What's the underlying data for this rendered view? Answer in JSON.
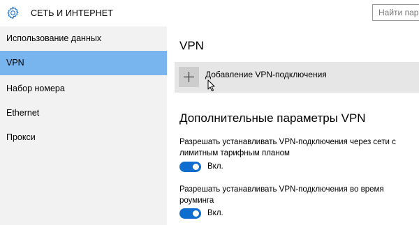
{
  "header": {
    "title": "СЕТЬ И ИНТЕРНЕТ",
    "search_placeholder": "Найти парам"
  },
  "sidebar": {
    "items": [
      {
        "label": "Использование данных",
        "active": false
      },
      {
        "label": "VPN",
        "active": true
      },
      {
        "label": "Набор номера",
        "active": false
      },
      {
        "label": "Ethernet",
        "active": false
      },
      {
        "label": "Прокси",
        "active": false
      }
    ]
  },
  "main": {
    "title": "VPN",
    "add_vpn_label": "Добавление VPN-подключения",
    "advanced_title": "Дополнительные параметры VPN",
    "settings": [
      {
        "description": "Разрешать устанавливать VPN-подключения через сети с лимитным тарифным планом",
        "toggle_label": "Вкл.",
        "on": true
      },
      {
        "description": "Разрешать устанавливать VPN-подключения во время роуминга",
        "toggle_label": "Вкл.",
        "on": true
      }
    ]
  },
  "colors": {
    "accent": "#0e6dcf",
    "selection": "#78b5ee",
    "sidebar_bg": "#f2f2f2",
    "add_bg": "#e6e6e6"
  }
}
